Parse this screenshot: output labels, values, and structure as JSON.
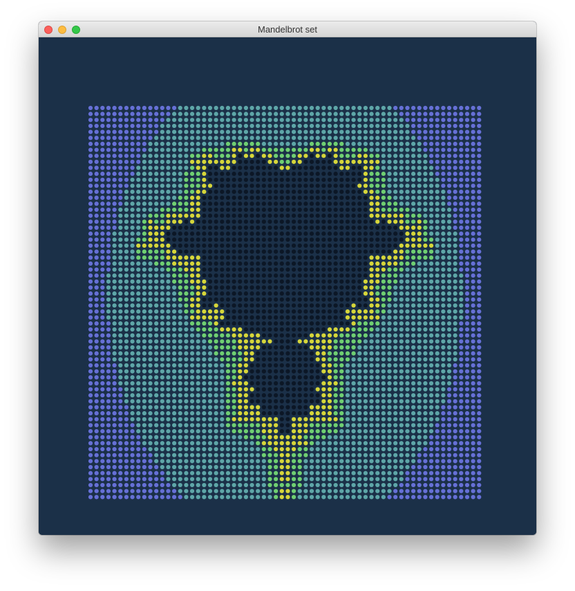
{
  "window": {
    "title": "Mandelbrot set"
  },
  "grid": {
    "columns": 66,
    "rows": 66
  },
  "colors": {
    "background": "#1b3048",
    "inside": "#0c1726",
    "band_outer": "#6670d6",
    "band_mid": "#5ea6a8",
    "band_near": "#6fcf72",
    "band_edge": "#d6d63a"
  }
}
